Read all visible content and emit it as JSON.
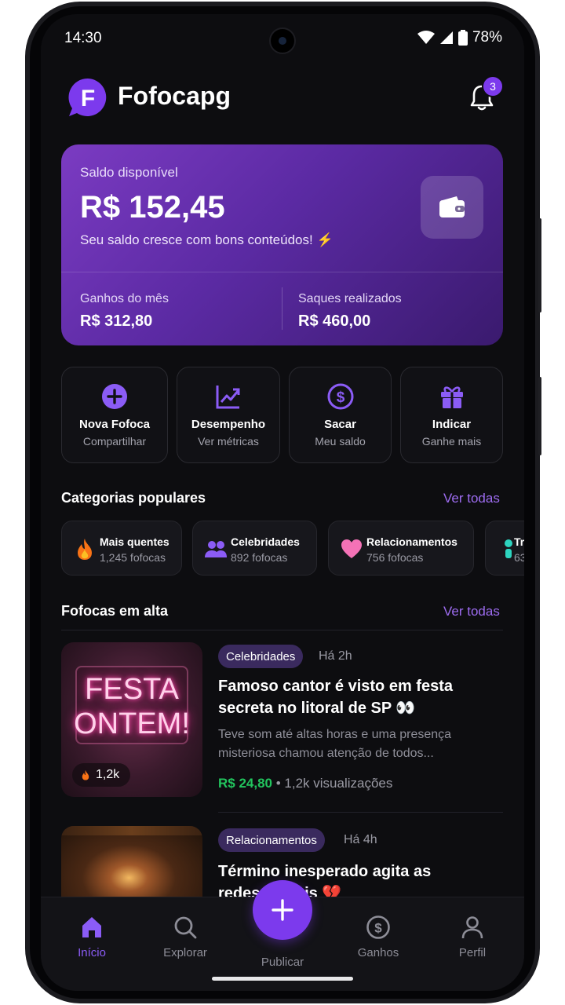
{
  "status_bar": {
    "time": "14:30",
    "battery": "78%"
  },
  "header": {
    "logo_letter": "F",
    "app_name": "Fofocapg",
    "notification_count": "3"
  },
  "balance_card": {
    "label": "Saldo disponível",
    "value": "R$ 152,45",
    "subtitle": "Seu saldo cresce com bons conteúdos! ⚡",
    "stats": [
      {
        "label": "Ganhos do mês",
        "value": "R$ 312,80"
      },
      {
        "label": "Saques realizados",
        "value": "R$ 460,00"
      }
    ]
  },
  "actions": [
    {
      "title": "Nova Fofoca",
      "subtitle": "Compartilhar",
      "icon": "plus-circle-icon"
    },
    {
      "title": "Desempenho",
      "subtitle": "Ver métricas",
      "icon": "trending-chart-icon"
    },
    {
      "title": "Sacar",
      "subtitle": "Meu saldo",
      "icon": "dollar-circle-icon"
    },
    {
      "title": "Indicar",
      "subtitle": "Ganhe mais",
      "icon": "gift-icon"
    }
  ],
  "categories": {
    "title": "Categorias populares",
    "see_all": "Ver todas",
    "items": [
      {
        "name": "Mais quentes",
        "count": "1,245 fofocas",
        "icon": "fire-icon"
      },
      {
        "name": "Celebridades",
        "count": "892 fofocas",
        "icon": "people-icon"
      },
      {
        "name": "Relacionamentos",
        "count": "756 fofocas",
        "icon": "heart-icon"
      },
      {
        "name": "Tr",
        "count": "63",
        "icon": "person-icon"
      }
    ]
  },
  "trending": {
    "title": "Fofocas em alta",
    "see_all": "Ver todas",
    "items": [
      {
        "tag": "Celebridades",
        "time": "Há 2h",
        "title_line1": "Famoso cantor é visto em festa",
        "title_line2": "secreta no litoral de SP 👀",
        "desc_line1": "Teve som até altas horas e uma presença",
        "desc_line2": "misteriosa chamou atenção de todos...",
        "price": "R$ 24,80",
        "views": "• 1,2k visualizações",
        "thumb_text_line1": "FESTA",
        "thumb_text_line2": "ONTEM!",
        "likes": "1,2k"
      },
      {
        "tag": "Relacionamentos",
        "time": "Há 4h",
        "title_line1": "Término inesperado agita as",
        "title_line2": "redes sociais 💔"
      }
    ]
  },
  "bottom_nav": {
    "items": [
      {
        "label": "Início",
        "icon": "home-icon",
        "active": true
      },
      {
        "label": "Explorar",
        "icon": "search-icon"
      },
      {
        "label": "Publicar",
        "icon": "plus-icon"
      },
      {
        "label": "Ganhos",
        "icon": "dollar-circle-icon"
      },
      {
        "label": "Perfil",
        "icon": "user-icon"
      }
    ]
  },
  "colors": {
    "accent": "#7c3aed",
    "price_green": "#22c55e",
    "background": "#0d0d10"
  }
}
